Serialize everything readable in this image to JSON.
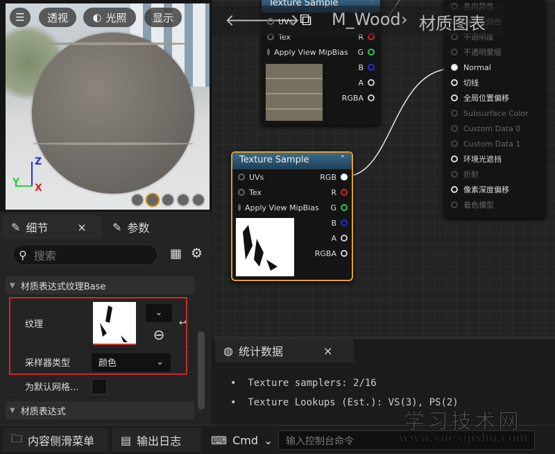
{
  "viewport": {
    "menu_icon": "hamburger-icon",
    "perspective": "透视",
    "lighting": "光照",
    "show": "显示",
    "axis": {
      "z": "Z",
      "y": "Y",
      "x": "X"
    },
    "colors": {
      "z": "#2030e0",
      "y": "#20d040",
      "x": "#e02020"
    }
  },
  "breadcrumb": {
    "asset": "M_Wood",
    "separator": "›",
    "page": "材质图表"
  },
  "node_top": {
    "title": "Texture Sample",
    "inputs": [
      "UVs",
      "Tex",
      "Apply View MipBias"
    ],
    "outputs": [
      "RGB",
      "R",
      "G",
      "B",
      "A",
      "RGBA"
    ]
  },
  "node_selected": {
    "title": "Texture Sample",
    "inputs": [
      "UVs",
      "Tex",
      "Apply View MipBias"
    ],
    "outputs": [
      "RGB",
      "R",
      "G",
      "B",
      "A",
      "RGBA"
    ],
    "accent": "#e8a020"
  },
  "result_node": {
    "pins": [
      {
        "label": "各向异性",
        "on": false
      },
      {
        "label": "自发光颜色",
        "on": false
      },
      {
        "label": "不透明度",
        "on": false
      },
      {
        "label": "不透明蒙版",
        "on": false
      },
      {
        "label": "Normal",
        "on": true
      },
      {
        "label": "切线",
        "on": true
      },
      {
        "label": "全局位置偏移",
        "on": true
      },
      {
        "label": "Subsurface Color",
        "on": false
      },
      {
        "label": "Custom Data 0",
        "on": false
      },
      {
        "label": "Custom Data 1",
        "on": false
      },
      {
        "label": "环境光遮挡",
        "on": true
      },
      {
        "label": "折射",
        "on": false
      },
      {
        "label": "像素深度偏移",
        "on": true
      },
      {
        "label": "着色模型",
        "on": false
      }
    ]
  },
  "details": {
    "tab1": "细节",
    "tab2": "参数",
    "close": "×",
    "search_placeholder": "搜索",
    "section1": "材质表达式纹理Base",
    "texture_label": "纹理",
    "sampler_label": "采样器类型",
    "sampler_value": "颜色",
    "default_mesh_label": "为默认网格...",
    "section2": "材质表达式"
  },
  "stats": {
    "tab": "统计数据",
    "close": "×",
    "lines": [
      "Texture samplers: 2/16",
      "Texture Lookups (Est.): VS(3), PS(2)"
    ]
  },
  "bottom": {
    "content_drawer": "内容侧滑菜单",
    "output_log": "输出日志",
    "cmd": "Cmd",
    "console_placeholder": "输入控制台命令"
  },
  "watermark": {
    "title": "学习技术网",
    "url": "www.xuexijishu.com"
  }
}
